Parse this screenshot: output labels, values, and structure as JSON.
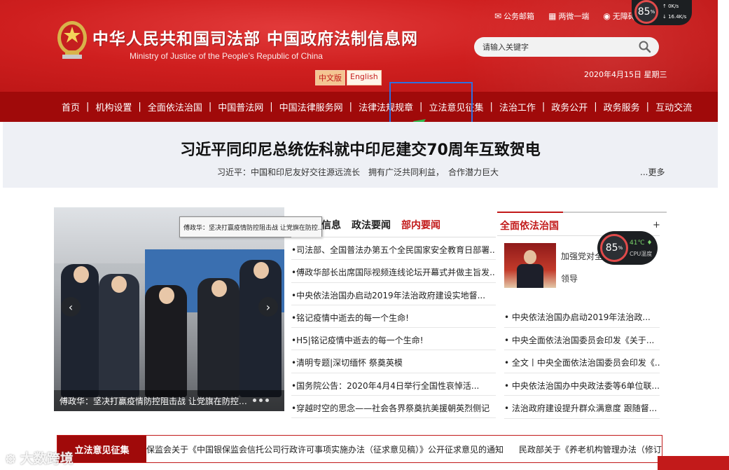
{
  "header": {
    "site_title": "中华人民共和国司法部  中国政府法制信息网",
    "site_subtitle": "Ministry of Justice of the People’s Republic of China",
    "lang_cn": "中文版",
    "lang_en": "English",
    "top_links": {
      "mail": "公务邮箱",
      "weixin": "两微一端",
      "accessibility": "无障碍"
    },
    "search_placeholder": "请输入关键字",
    "date": "2020年4月15日 星期三"
  },
  "net_widget": {
    "percent": "85",
    "percent_unit": "%",
    "upload": "0K/s",
    "download": "16.4K/s"
  },
  "nav": {
    "items": [
      "首页",
      "机构设置",
      "全面依法治国",
      "中国普法网",
      "中国法律服务网",
      "法律法规规章",
      "立法意见征集",
      "法治工作",
      "政务公开",
      "政务服务",
      "互动交流"
    ]
  },
  "headline": {
    "title": "习近平同印尼总统佐科就中印尼建交70周年互致贺电",
    "subtitle": "习近平：中国和印尼友好交往源远流长　拥有广泛共同利益，　合作潜力巨大",
    "more": "...更多"
  },
  "carousel": {
    "caption": "傅政华：坚决打赢疫情防控阻击战 让党旗在防控…",
    "tooltip": "傅政华：坚决打赢疫情防控阻击战 让党旗在防控..."
  },
  "news": {
    "tabs": [
      "信息",
      "政法要闻",
      "部内要闻"
    ],
    "items": [
      "•司法部、全国普法办第五个全民国家安全教育日部署...",
      "•傅政华部长出席国际视频连线论坛开幕式并做主旨发...",
      "•中央依法治国办启动2019年法治政府建设实地督...",
      "•铭记疫情中逝去的每一个生命!",
      "•H5|铭记疫情中逝去的每一个生命!",
      "•清明专题|深切缅怀 祭奠英模",
      "•国务院公告：2020年4月4日举行全国性哀悼活...",
      "•穿越时空的思念——社会各界祭奠抗美援朝英烈侧记"
    ]
  },
  "right_column": {
    "title": "全面依法治国",
    "plus": "+",
    "featured_line1": "加强党对全",
    "featured_line2": "领导",
    "items": [
      "• 中央依法治国办启动2019年法治政...",
      "• 中央全面依法治国委员会印发《关于...",
      "• 全文丨中央全面依法治国委员会印发《...",
      "• 中央依法治国办中央政法委等6单位联...",
      "• 法治政府建设提升群众满意度 跟随督..."
    ]
  },
  "cpu_widget": {
    "percent": "85",
    "percent_unit": "%",
    "temp": "41℃",
    "label": "CPU温度"
  },
  "bottom": {
    "label": "立法意见征集",
    "ticker": [
      "保监会关于《中国银保监会信托公司行政许可事项实施办法（征求意见稿）》公开征求意见的通知",
      "民政部关于《养老机构管理办法（修订草"
    ]
  },
  "watermark": "大数跨境",
  "colors": {
    "header_red": "#cf1f1f",
    "nav_red": "#a00a0a",
    "accent_red": "#c21a1a",
    "highlight_blue": "#2f6fe0",
    "arrow_green": "#2fb84a"
  }
}
